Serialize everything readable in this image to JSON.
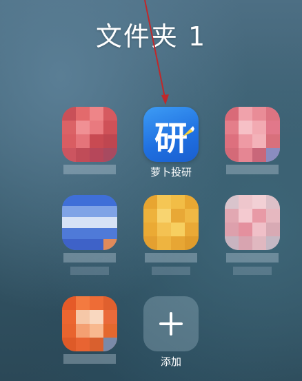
{
  "folder": {
    "title": "文件夹 1"
  },
  "apps": [
    {
      "label": "萝卜投研",
      "icon_char": "研",
      "icon": "luobo-touyan-app-icon"
    },
    {
      "label": "添加",
      "icon": "plus-icon"
    }
  ],
  "colors": {
    "app_blue": "#2b7fe8",
    "red_tile": "#e45a5a",
    "blue_tile": "#4a7ce0",
    "yellow_tile": "#f0b93a",
    "pink_tile": "#e8a0a8",
    "orange_tile": "#f06a30"
  }
}
